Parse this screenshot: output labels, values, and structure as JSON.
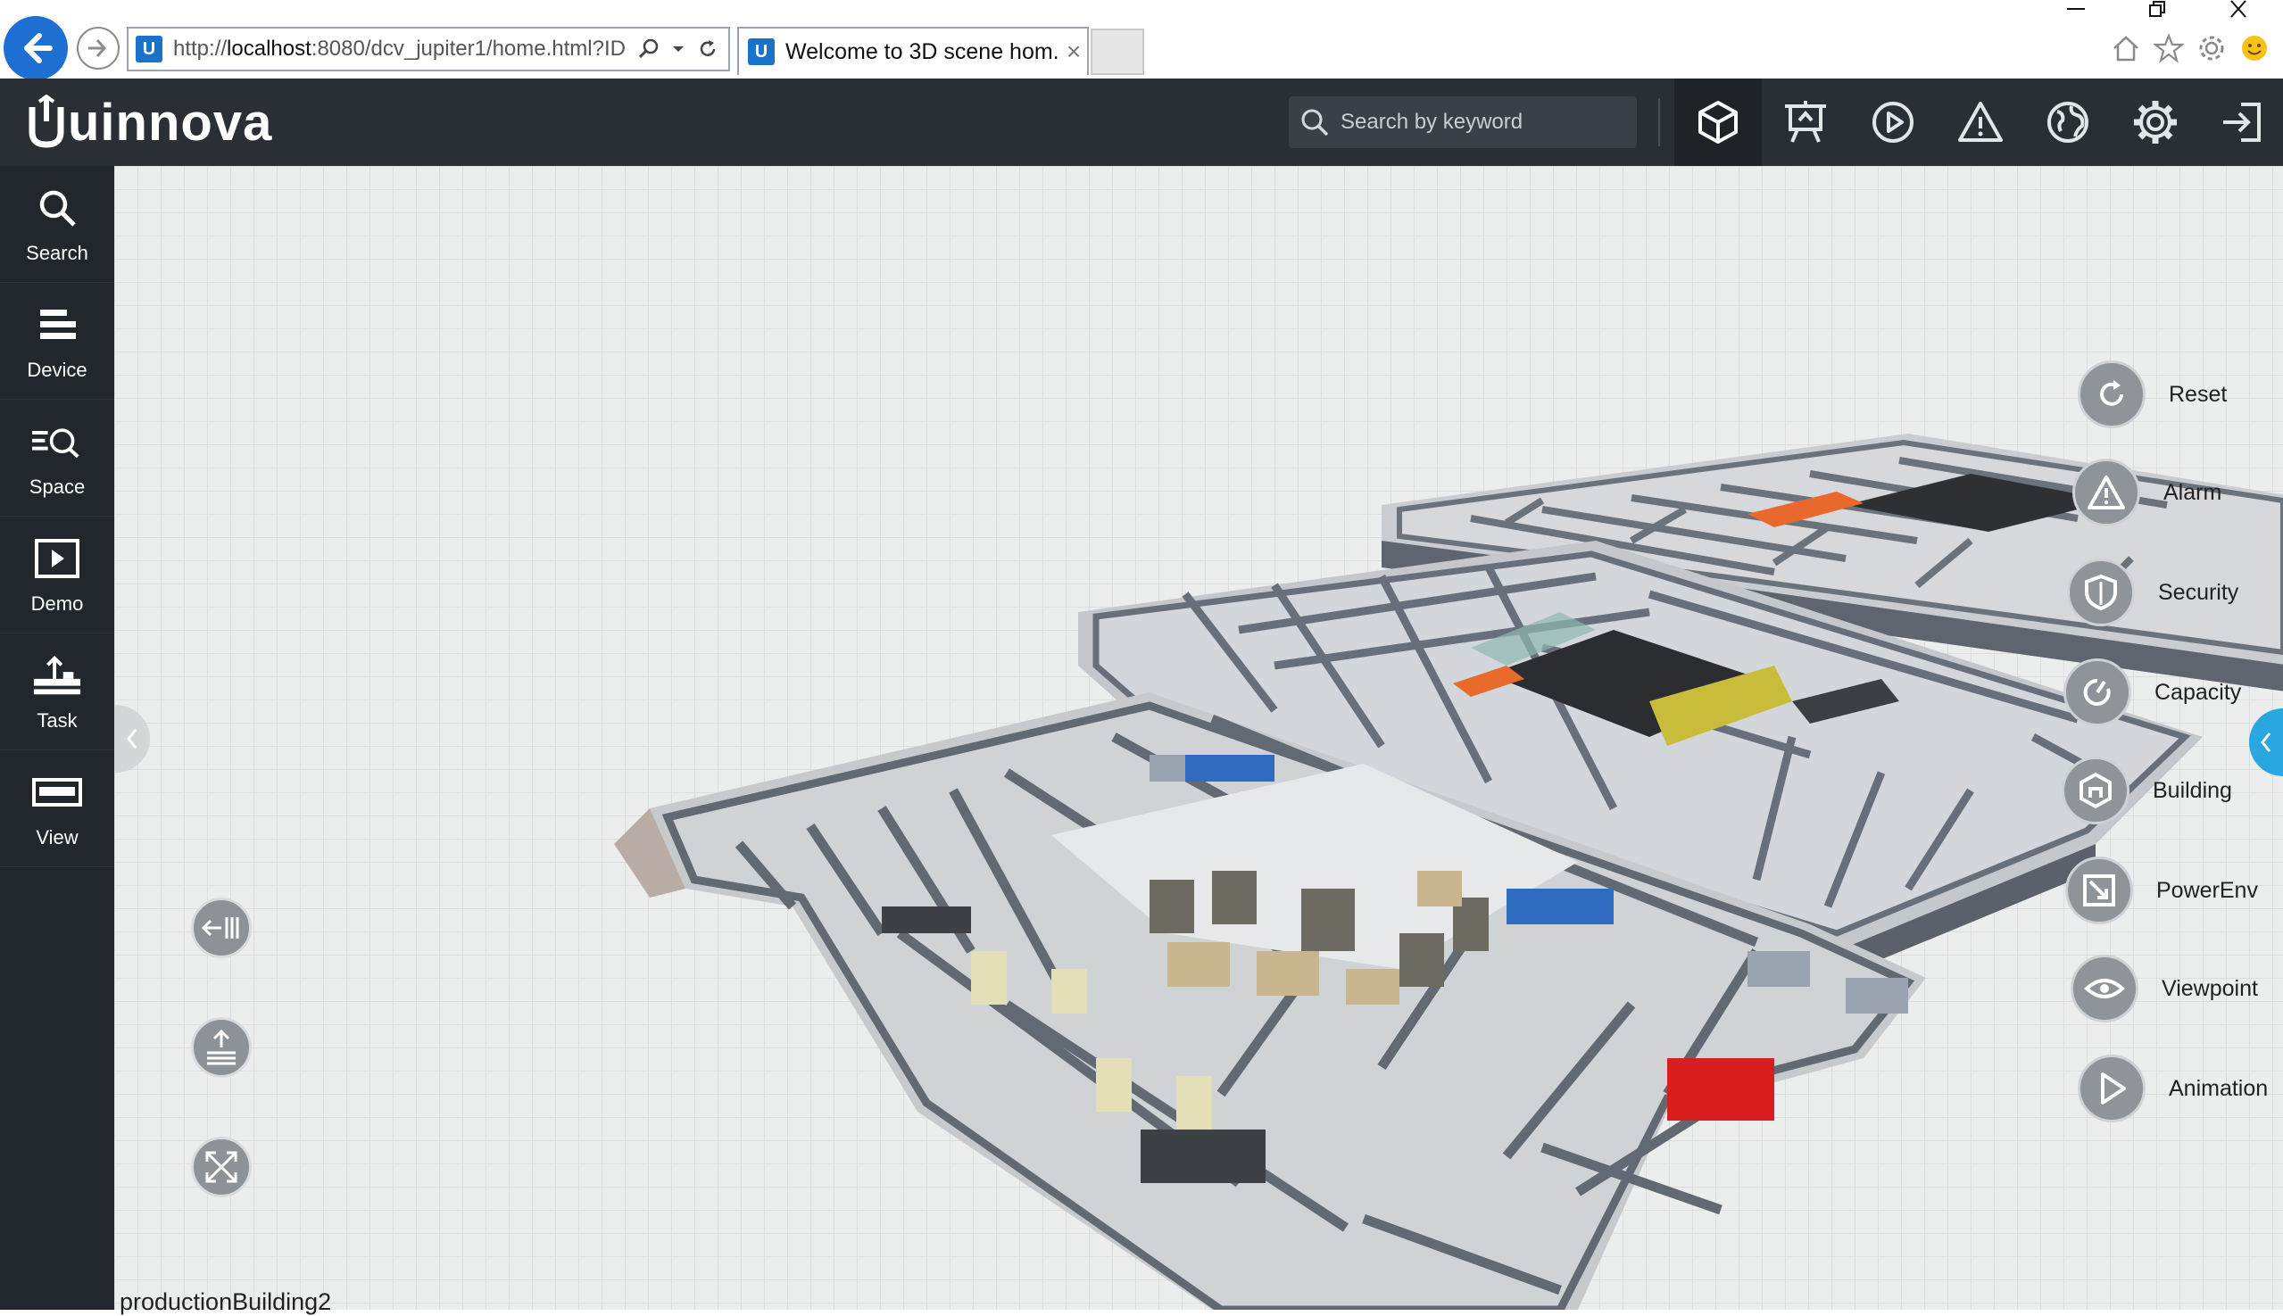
{
  "browser": {
    "url_prefix": "http://",
    "url_host": "localhost",
    "url_rest": ":8080/dcv_jupiter1/home.html?ID",
    "tab_title": "Welcome to 3D scene hom...",
    "tab_close": "×"
  },
  "header": {
    "brand": "uinnova",
    "search_placeholder": "Search by keyword",
    "icons": [
      "scene-cube-icon",
      "board-icon",
      "play-icon",
      "warning-icon",
      "globe-icon",
      "gear-icon",
      "logout-icon"
    ]
  },
  "sidebar": {
    "items": [
      {
        "label": "Search",
        "icon": "search-icon"
      },
      {
        "label": "Device",
        "icon": "device-icon"
      },
      {
        "label": "Space",
        "icon": "space-icon"
      },
      {
        "label": "Demo",
        "icon": "demo-icon"
      },
      {
        "label": "Task",
        "icon": "task-icon"
      },
      {
        "label": "View",
        "icon": "view-icon"
      }
    ]
  },
  "right_tools": [
    {
      "label": "Reset",
      "icon": "reset-icon"
    },
    {
      "label": "Alarm",
      "icon": "alarm-icon"
    },
    {
      "label": "Security",
      "icon": "security-icon"
    },
    {
      "label": "Capacity",
      "icon": "capacity-icon"
    },
    {
      "label": "Building",
      "icon": "building-icon"
    },
    {
      "label": "PowerEnv",
      "icon": "power-env-icon"
    },
    {
      "label": "Viewpoint",
      "icon": "viewpoint-icon"
    },
    {
      "label": "Animation",
      "icon": "animation-icon"
    }
  ],
  "left_tools": [
    "floor-split-icon",
    "floor-stack-icon",
    "fullscreen-icon"
  ],
  "scene": {
    "label": "productionBuilding2"
  },
  "colors": {
    "header_bg": "#2a2f35",
    "sidebar_bg": "#22272d",
    "accent_blue": "#2aa7e0",
    "browser_back": "#1d6fd1"
  }
}
